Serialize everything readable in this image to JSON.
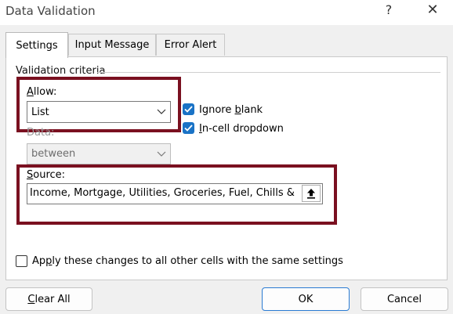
{
  "window": {
    "title": "Data Validation",
    "help_glyph": "?",
    "close_glyph": "✕"
  },
  "tabs": [
    {
      "label": "Settings",
      "active": true
    },
    {
      "label": "Input Message",
      "active": false
    },
    {
      "label": "Error Alert",
      "active": false
    }
  ],
  "criteria": {
    "group_label": "Validation criteria",
    "allow_label_first": "A",
    "allow_label_rest": "llow:",
    "allow_value": "List",
    "data_label": "Data:",
    "data_value": "between",
    "ignore_blank_pre": "Ignore ",
    "ignore_blank_underlined": "b",
    "ignore_blank_post": "lank",
    "ignore_blank_checked": true,
    "incell_underlined": "I",
    "incell_rest": "n-cell dropdown",
    "incell_checked": true,
    "source_label_first": "S",
    "source_label_rest": "ource:",
    "source_value": "Income, Mortgage, Utilities, Groceries, Fuel, Chills & Hangouts"
  },
  "apply_all": {
    "pre": "Ap",
    "underlined": "p",
    "post": "ly these changes to all other cells with the same settings",
    "checked": false
  },
  "buttons": {
    "clear_all_underlined": "C",
    "clear_all_rest": "lear All",
    "ok": "OK",
    "cancel": "Cancel"
  },
  "colors": {
    "highlight": "#7a1020",
    "checkbox": "#1a73c6",
    "ok_border": "#2a7bd3"
  }
}
